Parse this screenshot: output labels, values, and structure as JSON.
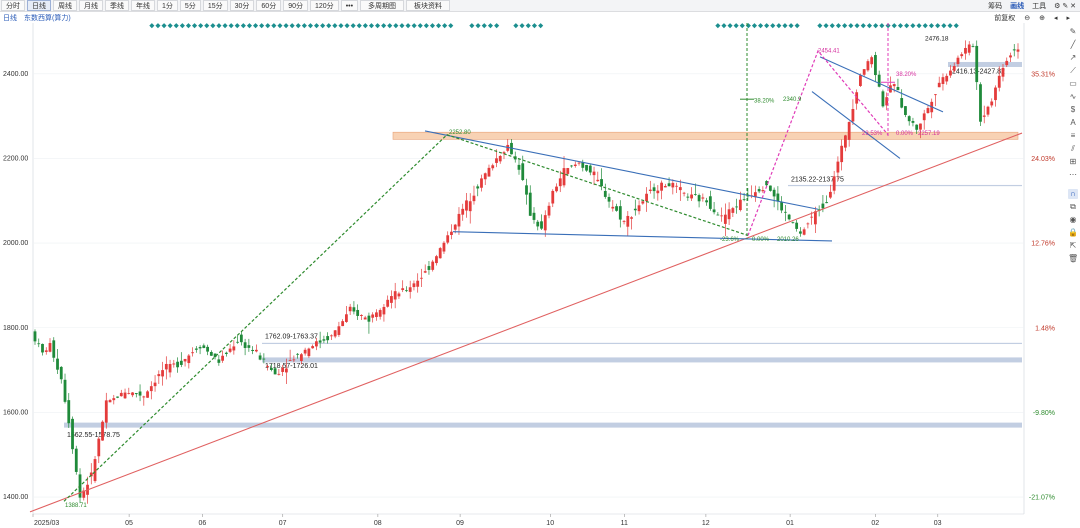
{
  "toolbar": {
    "tabs": [
      "分时",
      "日线",
      "周线",
      "月线",
      "季线",
      "年线",
      "1分",
      "5分",
      "15分",
      "30分",
      "60分",
      "90分",
      "120分",
      "•••",
      "多周期图",
      "板块资料"
    ],
    "active_tab": 1,
    "right": {
      "chip": "筹码",
      "draw": "画线",
      "tools": "工具"
    }
  },
  "subbar": {
    "period": "日线",
    "index_name": "东数西算(算力)",
    "adjust": "前复权"
  },
  "axis": {
    "y_ticks": [
      "2400.00",
      "2200.00",
      "2000.00",
      "1800.00",
      "1600.00",
      "1400.00"
    ],
    "pct_ticks": [
      "35.31%",
      "24.03%",
      "12.76%",
      "1.48%",
      "-9.80%",
      "-21.07%"
    ],
    "x_ticks": [
      "2025/03",
      "05",
      "06",
      "07",
      "08",
      "09",
      "10",
      "11",
      "12",
      "01",
      "02",
      "03"
    ]
  },
  "zones": [
    {
      "label": "1762.09-1763.37"
    },
    {
      "label": "1718.57-1726.01"
    },
    {
      "label": "1562.55-1578.75"
    },
    {
      "label": "2135.22-2137.75"
    },
    {
      "label": "2416.13-2427.82"
    }
  ],
  "annotations": {
    "low_label": "1388.71",
    "high_label": "2476.18",
    "fib_green_382": "38.20%",
    "fib_green_val": "2340.9",
    "swing_high_1": "2252.80",
    "fib_pink_382": "38.20%",
    "fib_pink_0": "0.00%",
    "fib_pink_val": "2257.19",
    "peak_jan": "2454.41",
    "fib_pink_pct": "23.53%",
    "low_dec": "2010.26",
    "fib_dec_0": "0.00%",
    "fib_dec_neg": "-23.6%"
  },
  "chart_data": {
    "type": "candlestick",
    "title": "东数西算(算力)",
    "ylim": [
      1360,
      2520
    ],
    "y_ticks": [
      1400,
      1600,
      1800,
      2000,
      2200,
      2400
    ],
    "x_tick_labels": [
      "2025/03",
      "05",
      "06",
      "07",
      "08",
      "09",
      "10",
      "11",
      "12",
      "01",
      "02",
      "03"
    ],
    "key_levels": {
      "low": 1388.71,
      "high": 2476.18,
      "swing_high_aug": 2252.8,
      "low_dec": 2010.26,
      "peak_jan": 2454.41,
      "pullback_feb": 2257.19
    },
    "support_zones": [
      [
        1762.09,
        1763.37
      ],
      [
        1718.57,
        1726.01
      ],
      [
        1562.55,
        1578.75
      ],
      [
        2135.22,
        2137.75
      ],
      [
        2416.13,
        2427.82
      ]
    ],
    "resistance_zone": [
      2245,
      2262
    ],
    "path_points": [
      [
        0,
        1790
      ],
      [
        3,
        1740
      ],
      [
        5,
        1760
      ],
      [
        8,
        1680
      ],
      [
        10,
        1580
      ],
      [
        13,
        1400
      ],
      [
        16,
        1450
      ],
      [
        20,
        1620
      ],
      [
        25,
        1650
      ],
      [
        30,
        1640
      ],
      [
        35,
        1700
      ],
      [
        40,
        1720
      ],
      [
        45,
        1760
      ],
      [
        50,
        1720
      ],
      [
        55,
        1770
      ],
      [
        60,
        1740
      ],
      [
        65,
        1690
      ],
      [
        70,
        1730
      ],
      [
        75,
        1760
      ],
      [
        80,
        1780
      ],
      [
        85,
        1840
      ],
      [
        90,
        1820
      ],
      [
        95,
        1870
      ],
      [
        100,
        1890
      ],
      [
        105,
        1930
      ],
      [
        110,
        2000
      ],
      [
        115,
        2080
      ],
      [
        120,
        2150
      ],
      [
        124,
        2200
      ],
      [
        127,
        2230
      ],
      [
        130,
        2180
      ],
      [
        133,
        2070
      ],
      [
        136,
        2030
      ],
      [
        139,
        2120
      ],
      [
        142,
        2170
      ],
      [
        146,
        2190
      ],
      [
        150,
        2160
      ],
      [
        154,
        2100
      ],
      [
        158,
        2050
      ],
      [
        162,
        2090
      ],
      [
        166,
        2130
      ],
      [
        170,
        2140
      ],
      [
        175,
        2110
      ],
      [
        180,
        2100
      ],
      [
        184,
        2060
      ],
      [
        188,
        2090
      ],
      [
        192,
        2120
      ],
      [
        196,
        2140
      ],
      [
        200,
        2080
      ],
      [
        205,
        2020
      ],
      [
        208,
        2060
      ],
      [
        212,
        2100
      ],
      [
        215,
        2190
      ],
      [
        218,
        2290
      ],
      [
        221,
        2400
      ],
      [
        224,
        2440
      ],
      [
        227,
        2330
      ],
      [
        230,
        2380
      ],
      [
        233,
        2300
      ],
      [
        236,
        2270
      ],
      [
        239,
        2320
      ],
      [
        242,
        2380
      ],
      [
        245,
        2410
      ],
      [
        248,
        2450
      ],
      [
        251,
        2470
      ],
      [
        253,
        2290
      ],
      [
        256,
        2340
      ],
      [
        259,
        2420
      ],
      [
        262,
        2460
      ]
    ]
  },
  "sidebar": {
    "icons": [
      "pin-icon",
      "line-icon",
      "ray-icon",
      "segment-icon",
      "rect-icon",
      "brush-icon",
      "price-icon",
      "text-icon",
      "fib-icon",
      "channel-icon",
      "measure-icon",
      "more-icon",
      "magnet-icon",
      "layers-icon",
      "eye-icon",
      "lock-icon",
      "share-icon",
      "delete-icon"
    ]
  },
  "colors": {
    "up": "#e43b3b",
    "down": "#1f8a3a",
    "trend_red": "#e06060",
    "channel_blue": "#3a6fb8",
    "fib_green": "#2e8b2e",
    "fib_pink": "#e03bb8",
    "zone_blue": "#b7c5dd",
    "zone_orange": "#f8d2b4"
  }
}
